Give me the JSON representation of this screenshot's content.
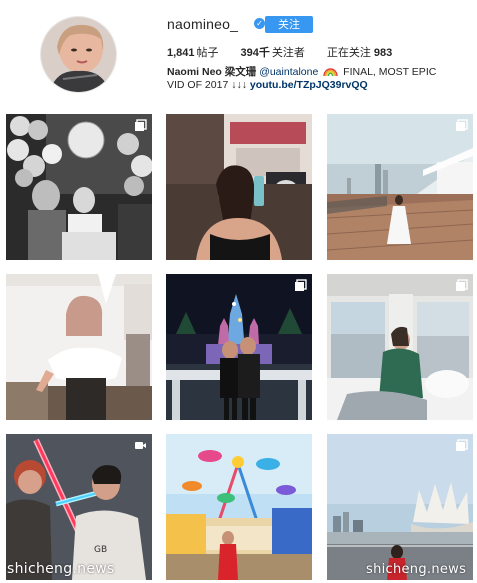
{
  "profile": {
    "username": "naomineo_",
    "verified_icon": "verified-badge-icon",
    "follow_label": "关注",
    "stats": {
      "posts_count": "1,841",
      "posts_label": "帖子",
      "followers_count": "394千",
      "followers_label": "关注者",
      "following_label": "正在关注",
      "following_count": "983"
    },
    "bio": {
      "full_name": "Naomi Neo",
      "chinese_name": "梁文珊",
      "mention": "@uaintalone",
      "line1_rest": "FINAL, MOST EPIC",
      "line2_text": "VID OF 2017 ↓↓↓",
      "link": "youtu.be/TZpJQ39rvQQ"
    }
  },
  "posts": [
    {
      "alt": "birthday-photo",
      "badge": "multi-icon"
    },
    {
      "alt": "mirror-selfie",
      "badge": "none"
    },
    {
      "alt": "boardwalk-photo",
      "badge": "multi-icon"
    },
    {
      "alt": "white-top-portrait",
      "badge": "none"
    },
    {
      "alt": "castle-couple-photo",
      "badge": "multi-icon"
    },
    {
      "alt": "window-seat-photo",
      "badge": "multi-icon"
    },
    {
      "alt": "lightsaber-video",
      "badge": "video-icon"
    },
    {
      "alt": "carnival-photo",
      "badge": "none"
    },
    {
      "alt": "artscience-museum-photo",
      "badge": "multi-icon"
    }
  ],
  "watermark": {
    "left": "shicheng.news",
    "right": "shicheng.news"
  }
}
